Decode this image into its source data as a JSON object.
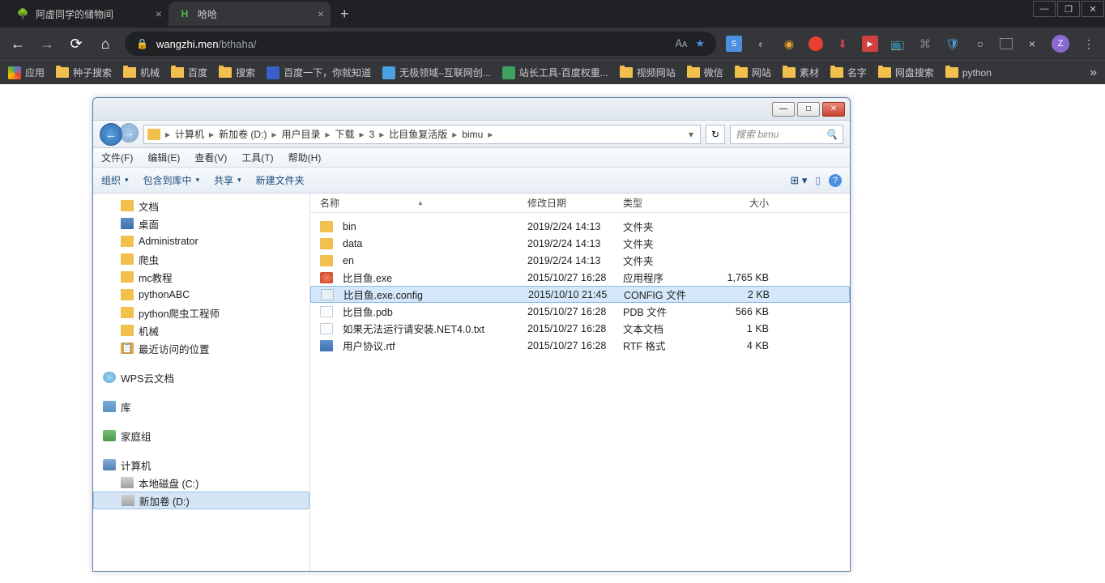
{
  "browser": {
    "tabs": [
      {
        "title": "阿虚同学的储物间",
        "active": false
      },
      {
        "title": "哈哈",
        "active": true
      }
    ],
    "url_host": "wangzhi.men",
    "url_path": "/bthaha/",
    "bookmarks": [
      {
        "label": "应用",
        "type": "apps"
      },
      {
        "label": "种子搜索",
        "type": "folder"
      },
      {
        "label": "机械",
        "type": "folder"
      },
      {
        "label": "百度",
        "type": "folder"
      },
      {
        "label": "搜索",
        "type": "folder"
      },
      {
        "label": "百度一下，你就知道",
        "type": "link"
      },
      {
        "label": "无极领域–互联网创...",
        "type": "link"
      },
      {
        "label": "站长工具-百度权重...",
        "type": "link"
      },
      {
        "label": "视频网站",
        "type": "folder"
      },
      {
        "label": "微信",
        "type": "folder"
      },
      {
        "label": "网站",
        "type": "folder"
      },
      {
        "label": "素材",
        "type": "folder"
      },
      {
        "label": "名字",
        "type": "folder"
      },
      {
        "label": "网盘搜索",
        "type": "folder"
      },
      {
        "label": "python",
        "type": "folder"
      }
    ]
  },
  "explorer": {
    "breadcrumb": [
      "计算机",
      "新加卷 (D:)",
      "用户目录",
      "下载",
      "3",
      "比目鱼复活版",
      "bimu"
    ],
    "search_placeholder": "搜索 bimu",
    "menu": {
      "file": "文件(F)",
      "edit": "编辑(E)",
      "view": "查看(V)",
      "tools": "工具(T)",
      "help": "帮助(H)"
    },
    "toolbar": {
      "organize": "组织",
      "include": "包含到库中",
      "share": "共享",
      "new_folder": "新建文件夹"
    },
    "columns": {
      "name": "名称",
      "date": "修改日期",
      "type": "类型",
      "size": "大小"
    },
    "tree": {
      "docs": "文档",
      "desktop": "桌面",
      "admin": "Administrator",
      "spider": "爬虫",
      "mc": "mc教程",
      "pyabc": "pythonABC",
      "pyspider": "python爬虫工程师",
      "mech": "机械",
      "recent": "最近访问的位置",
      "wps": "WPS云文档",
      "lib": "库",
      "home": "家庭组",
      "computer": "计算机",
      "cdrive": "本地磁盘 (C:)",
      "ddrive": "新加卷 (D:)"
    },
    "files": [
      {
        "name": "bin",
        "date": "2019/2/24 14:13",
        "type": "文件夹",
        "size": "",
        "icon": "folder"
      },
      {
        "name": "data",
        "date": "2019/2/24 14:13",
        "type": "文件夹",
        "size": "",
        "icon": "folder"
      },
      {
        "name": "en",
        "date": "2019/2/24 14:13",
        "type": "文件夹",
        "size": "",
        "icon": "folder"
      },
      {
        "name": "比目鱼.exe",
        "date": "2015/10/27 16:28",
        "type": "应用程序",
        "size": "1,765 KB",
        "icon": "exe"
      },
      {
        "name": "比目鱼.exe.config",
        "date": "2015/10/10 21:45",
        "type": "CONFIG 文件",
        "size": "2 KB",
        "icon": "config",
        "selected": true
      },
      {
        "name": "比目鱼.pdb",
        "date": "2015/10/27 16:28",
        "type": "PDB 文件",
        "size": "566 KB",
        "icon": "file"
      },
      {
        "name": "如果无法运行请安装.NET4.0.txt",
        "date": "2015/10/27 16:28",
        "type": "文本文档",
        "size": "1 KB",
        "icon": "file"
      },
      {
        "name": "用户协议.rtf",
        "date": "2015/10/27 16:28",
        "type": "RTF 格式",
        "size": "4 KB",
        "icon": "rtf"
      }
    ]
  }
}
